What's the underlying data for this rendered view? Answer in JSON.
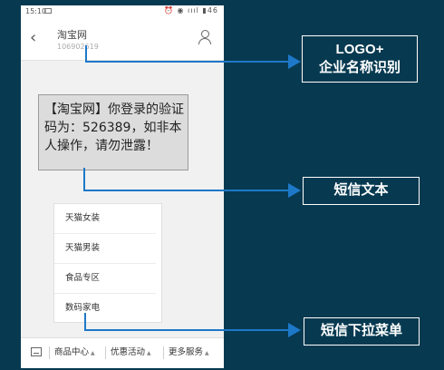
{
  "statusbar": {
    "time": "15:10",
    "icons": "⏰ ◉ ıııl ▮46"
  },
  "header": {
    "sender_name": "淘宝网",
    "sender_number": "106902619"
  },
  "message": {
    "text": "【淘宝网】你登录的验证码为：526389，如非本人操作，请勿泄露！"
  },
  "dropdown_menu": {
    "items": [
      "天猫女装",
      "天猫男装",
      "食品专区",
      "数码家电"
    ]
  },
  "tabbar": {
    "tabs": [
      "商品中心",
      "优惠活动",
      "更多服务"
    ]
  },
  "annotations": {
    "logo_line1": "LOGO+",
    "logo_line2": "企业名称识别",
    "text_label": "短信文本",
    "menu_label": "短信下拉菜单"
  },
  "colors": {
    "background": "#073a51",
    "arrow": "#1e78c8",
    "bubble": "#dcdcdc"
  }
}
